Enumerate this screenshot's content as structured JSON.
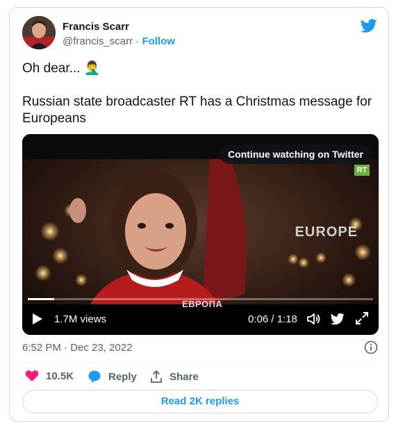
{
  "author": {
    "name": "Francis Scarr",
    "handle": "@francis_scarr",
    "separator": "·",
    "follow_label": "Follow"
  },
  "tweet": {
    "line1": "Oh dear... 🤦‍♂️",
    "line2": "Russian state broadcaster RT has a Christmas message for Europeans"
  },
  "video": {
    "continue_label": "Continue watching on Twitter",
    "channel_badge": "RT",
    "overlay_label": "EUROPE",
    "subtitle": "ЕВРОПА",
    "views": "1.7M views",
    "time": "0:06 / 1:18",
    "progress_fraction": 0.077
  },
  "meta": {
    "timestamp": "6:52 PM · Dec 23, 2022"
  },
  "actions": {
    "likes": "10.5K",
    "reply_label": "Reply",
    "share_label": "Share"
  },
  "replies_button": "Read 2K replies",
  "colors": {
    "accent": "#1d9bf0",
    "like": "#f91880",
    "text": "#0f1419",
    "muted": "#536471"
  }
}
